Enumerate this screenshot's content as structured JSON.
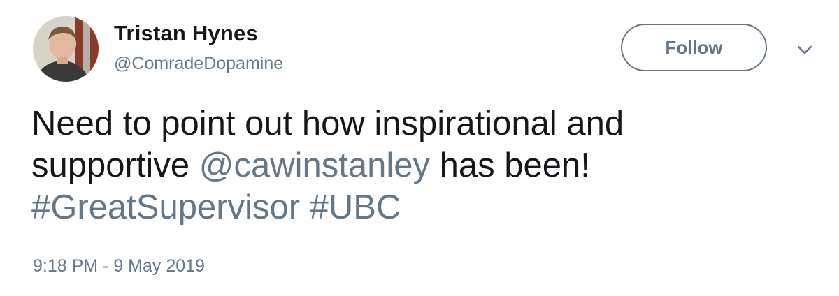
{
  "user": {
    "name": "Tristan Hynes",
    "handle": "@ComradeDopamine",
    "avatar_icon": "profile-photo"
  },
  "follow": {
    "label": "Follow"
  },
  "menu": {
    "icon": "chevron-down-icon"
  },
  "tweet": {
    "line1": "Need to point out how inspirational and",
    "line2_prefix": "supportive ",
    "mention": "@cawinstanley",
    "line2_suffix": " has been!",
    "hashtag1": "#GreatSupervisor",
    "hashtag_sep": " ",
    "hashtag2": "#UBC",
    "timestamp": "9:18 PM - 9 May 2019"
  },
  "colors": {
    "text": "#14171a",
    "muted": "#657786",
    "background": "#ffffff"
  }
}
